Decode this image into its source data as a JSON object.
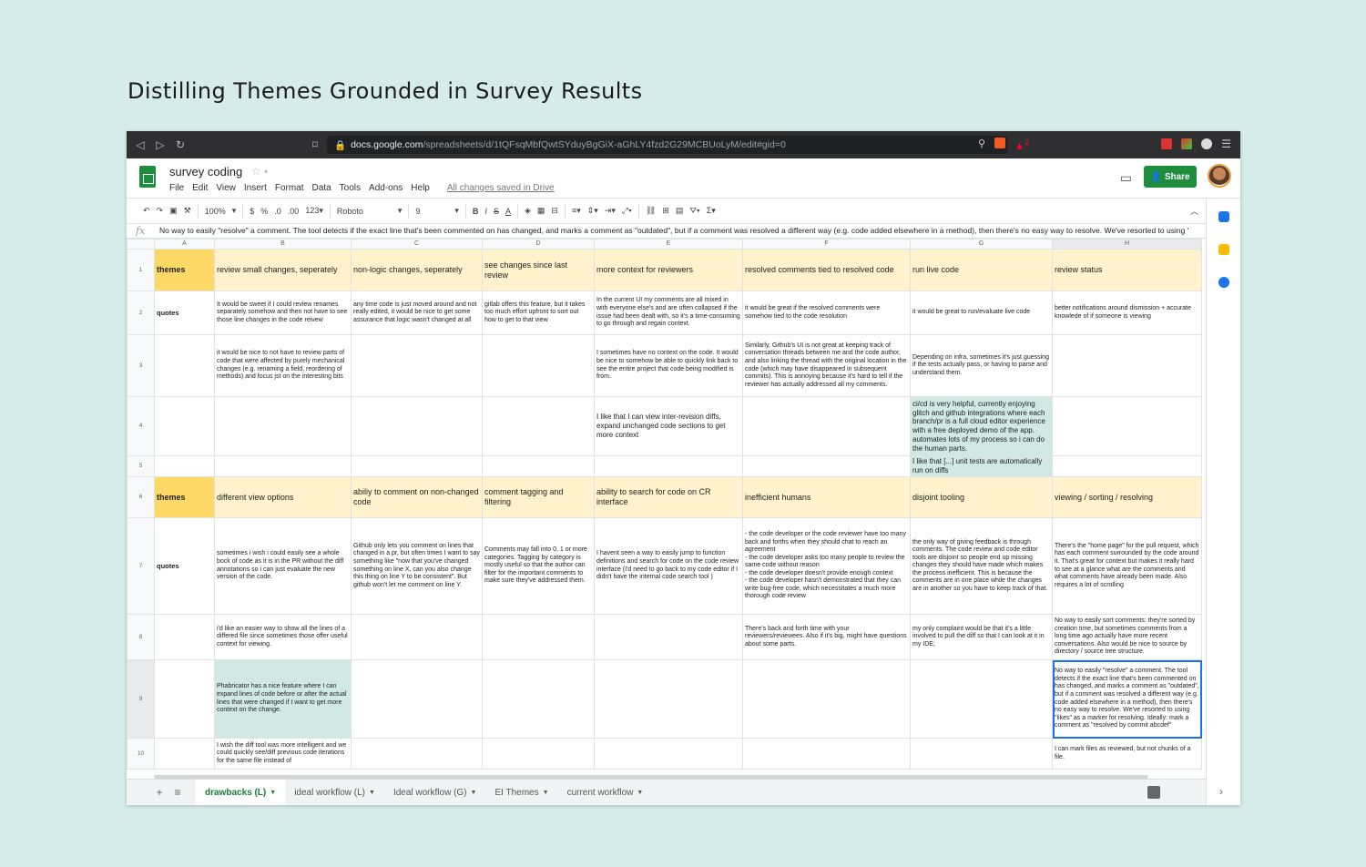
{
  "headline": "Distilling Themes Grounded in Survey Results",
  "browser": {
    "back": "◁",
    "forward": "▷",
    "reload": "↻",
    "bookmark": "⌑",
    "url_host": "docs.google.com",
    "url_path": "/spreadsheets/d/1tQFsqMbfQwtSYduyBgGiX-aGhLY4fzd2G29MCBUoLyM/edit#gid=0",
    "ext_badge": "2",
    "menu": "☰"
  },
  "doc": {
    "title": "survey coding",
    "title_icons": "☆ ▪",
    "menus": [
      "File",
      "Edit",
      "View",
      "Insert",
      "Format",
      "Data",
      "Tools",
      "Add-ons",
      "Help"
    ],
    "saved": "All changes saved in Drive",
    "share": "Share"
  },
  "toolbar": {
    "items": [
      "↶",
      "↷",
      "🖶",
      "⚲",
      "100%",
      "$",
      "%",
      ".0",
      ".00",
      "123",
      "Roboto",
      "9",
      "B",
      "I",
      "S",
      "A"
    ],
    "zoom": "100%",
    "font": "Roboto",
    "size": "9"
  },
  "formula": {
    "fx": "fx",
    "text": "No way to easily \"resolve\" a comment. The tool detects if the exact line that's been commented on has changed, and marks a comment as \"outdated\", but if a comment was resolved a different way (e.g. code added elsewhere in a method), then there's no easy way to resolve. We've resorted to using \"likes\" as a marker for resolving. Ideally: mark a comment as \"resolved by commit abcdef\""
  },
  "columns": [
    "A",
    "B",
    "C",
    "D",
    "E",
    "F",
    "G",
    "H"
  ],
  "rows": [
    {
      "num": "1",
      "cells": [
        "themes",
        "review small changes, seperately",
        "non-logic changes, seperately",
        "see changes since last review",
        "more context for reviewers",
        "resolved comments tied to resolved code",
        "run live code",
        "review status"
      ]
    },
    {
      "num": "2",
      "cells": [
        "quotes",
        "It would be sweet if I could review renames separately somehow and then not have to see those line changes in the code reivew",
        "any time code is just moved around and not really edited, it would be nice to get some assurance that logic wasn't changed at all",
        "gitlab offers this feature, but it takes too much effort upfront to sort out how to get to that view",
        "In the current UI my comments are all mixed in with everyone else's and are often collapsed if the issue had been dealt with, so it's a time-consuming to go through and regain context.",
        "it would be great if the resolved comments were somehow tied to the code resolution",
        "it would be great to run/evaluate live code",
        "better notifications around dismission + accurate knowlede of if someone is viewing"
      ]
    },
    {
      "num": "3",
      "cells": [
        "",
        "it would be nice to not have to review parts of code that were affected by purely mechanical changes (e.g. renaming a field, reordering of methods) and focus jst on the interesting bits",
        "",
        "",
        "I sometimes have no context on the code. It would be nice to somehow be able to quickly link back to see the entire project that code being modified is from.",
        "Similarly, Github's UI is not great at keeping track of conversation threads between me and the code author, and also linking the thread with the original location in the code (which may have disappeared in subsequent commits). This is annoying because it's hard to tell if the reviewer has actually addressed all my comments.",
        "Depending on infra, sometimes it's just guessing if the tests actually pass, or having to parse and understand them.",
        ""
      ]
    },
    {
      "num": "4",
      "cells": [
        "",
        "",
        "",
        "",
        "I like that I can view inter-revision diffs, expand unchanged code sections to get more context",
        "",
        "ci/cd is very helpful, currently enjoying glitch and github integrations where each branch/pr is a full cloud editor experience with a free deployed demo of the app. automates lots of my process so i can do the human parts.",
        ""
      ]
    },
    {
      "num": "5",
      "cells": [
        "",
        "",
        "",
        "",
        "",
        "",
        "I like that [...] unit tests are automatically run on diffs",
        ""
      ]
    },
    {
      "num": "6",
      "cells": [
        "themes",
        "different view options",
        "abiliy to comment on non-changed code",
        "comment tagging and filtering",
        "ability to search for code on CR interface",
        "inefficient humans",
        "disjoint tooling",
        "viewing / sorting / resolving"
      ]
    },
    {
      "num": "7",
      "cells": [
        "quotes",
        "sometimes i wish i could easily see a whole bock of code as it is in the PR without the diff annotations so i can just evaluate the new version of the code.",
        "Github only lets you comment on lines that changed in a pr, but often times I want to say something like \"now that you've changed something on line X, can you also change this thing on line Y to be consistent\". But github won't let me comment on line Y.",
        "Comments may fall into 0, 1 or more categories. Tagging by category is mostly useful so that the author can filter for the important comments to make sure they've addressed them.",
        "I havent seen a way to easily jump to function definitions and search for code on the code review interface (I'd need to go back to my code editor if I didn't have the internal code search tool )",
        "- the code developer or the code reviewer have too many back and forths when they should chat to reach an agreement\n- the code developer asks too many people to review the same code without reason\n- the code developer doesn't provide enough context\n- the code developer hasn't demonstrated that they can write bug-free code, which necessitates a much more thorough code review",
        "the only way of giving feedback is through comments. The code review and code editor tools are disjoint so people end up missing changes they should have made which makes the process inefficient. This is because the comments are in one place while the changes are in another so you have to keep track of that.",
        "There's the \"home page\" for the pull request, which has each comment surrounded by the code around it. That's great for context but makes it really hard to see at a glance what are the comments and what comments have already been made. Also requires a lot of scrolling"
      ]
    },
    {
      "num": "8",
      "cells": [
        "",
        "i'd like an easier way to show all the lines of a differed file since sometimes those offer useful context for viewing.",
        "",
        "",
        "",
        "There's back and forth time with your reviewers/reviewees. Also if it's big, might have questions about some parts.",
        "my only complaint would be that it's a little involved to pull the diff so that I can look at it in my IDE;",
        "No way to easily sort comments: they're sorted by creation time, but sometimes comments from a long time ago actually have more recent conversations. Also would be nice to source by directory / source tree structure."
      ]
    },
    {
      "num": "9",
      "cells": [
        "",
        "Phabricator has a nice feature where I can expand lines of code before or after the actual lines that were changed if I want to get more context on the change.",
        "",
        "",
        "",
        "",
        "",
        "No way to easily \"resolve\" a comment. The tool detects if the exact line that's been commented on has changed, and marks a comment as \"outdated\", but if a comment was resolved a different way (e.g. code added elsewhere in a method), then there's no easy way to resolve. We've resorted to using \"likes\" as a marker for resolving. Ideally: mark a comment as \"resolved by commit abcdef\""
      ]
    },
    {
      "num": "10",
      "cells": [
        "",
        "I wish the diff tool was more intelligent and we could quickly see/diff previous code iterations for the same file instead of",
        "",
        "",
        "",
        "",
        "",
        "I can mark files as reviewed, but not chunks of a file."
      ]
    }
  ],
  "sheet_tabs": [
    "drawbacks (L)",
    "ideal workflow (L)",
    "Ideal workflow (G)",
    "EI Themes",
    "current workflow"
  ],
  "tab_controls": {
    "add": "+",
    "all": "≡"
  },
  "colors": {
    "theme_label": "#ffd966",
    "theme_row": "#fff2cc",
    "highlight": "#d0e9e5",
    "share": "#1e8e3e",
    "active_tab": "#188038"
  }
}
